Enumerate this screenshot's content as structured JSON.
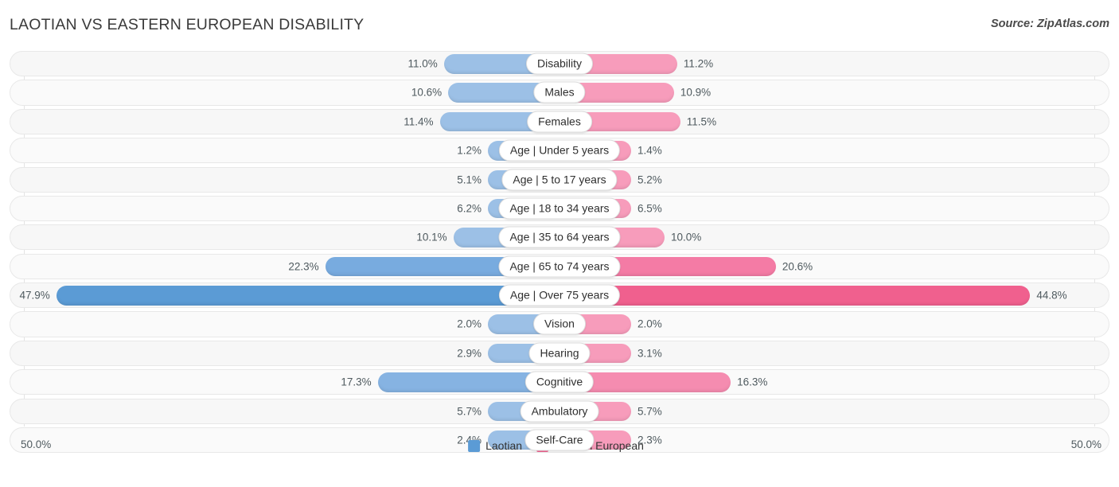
{
  "header": {
    "title": "LAOTIAN VS EASTERN EUROPEAN DISABILITY",
    "source": "Source: ZipAtlas.com"
  },
  "axis": {
    "left_label": "50.0%",
    "right_label": "50.0%"
  },
  "legend": {
    "items": [
      {
        "label": "Laotian",
        "color": "#5b9bd5"
      },
      {
        "label": "Eastern European",
        "color": "#f0608e"
      }
    ]
  },
  "chart_data": {
    "type": "bar",
    "title": "LAOTIAN VS EASTERN EUROPEAN DISABILITY",
    "subtitle": "Source: ZipAtlas.com",
    "orientation": "horizontal-diverging",
    "xlabel": "",
    "ylabel": "",
    "xlim": [
      -50.0,
      50.0
    ],
    "axis_left_label": "50.0%",
    "axis_right_label": "50.0%",
    "grid": false,
    "legend_position": "bottom-center",
    "categories": [
      "Disability",
      "Males",
      "Females",
      "Age | Under 5 years",
      "Age | 5 to 17 years",
      "Age | 18 to 34 years",
      "Age | 35 to 64 years",
      "Age | 65 to 74 years",
      "Age | Over 75 years",
      "Vision",
      "Hearing",
      "Cognitive",
      "Ambulatory",
      "Self-Care"
    ],
    "series": [
      {
        "name": "Laotian",
        "color": "#5b9bd5",
        "values": [
          11.0,
          10.6,
          11.4,
          1.2,
          5.1,
          6.2,
          10.1,
          22.3,
          47.9,
          2.0,
          2.9,
          17.3,
          5.7,
          2.4
        ],
        "labels": [
          "11.0%",
          "10.6%",
          "11.4%",
          "1.2%",
          "5.1%",
          "6.2%",
          "10.1%",
          "22.3%",
          "47.9%",
          "2.0%",
          "2.9%",
          "17.3%",
          "5.7%",
          "2.4%"
        ]
      },
      {
        "name": "Eastern European",
        "color": "#f0608e",
        "values": [
          11.2,
          10.9,
          11.5,
          1.4,
          5.2,
          6.5,
          10.0,
          20.6,
          44.8,
          2.0,
          3.1,
          16.3,
          5.7,
          2.3
        ],
        "labels": [
          "11.2%",
          "10.9%",
          "11.5%",
          "1.4%",
          "5.2%",
          "6.5%",
          "10.0%",
          "20.6%",
          "44.8%",
          "2.0%",
          "3.1%",
          "16.3%",
          "5.7%",
          "2.3%"
        ]
      }
    ]
  }
}
